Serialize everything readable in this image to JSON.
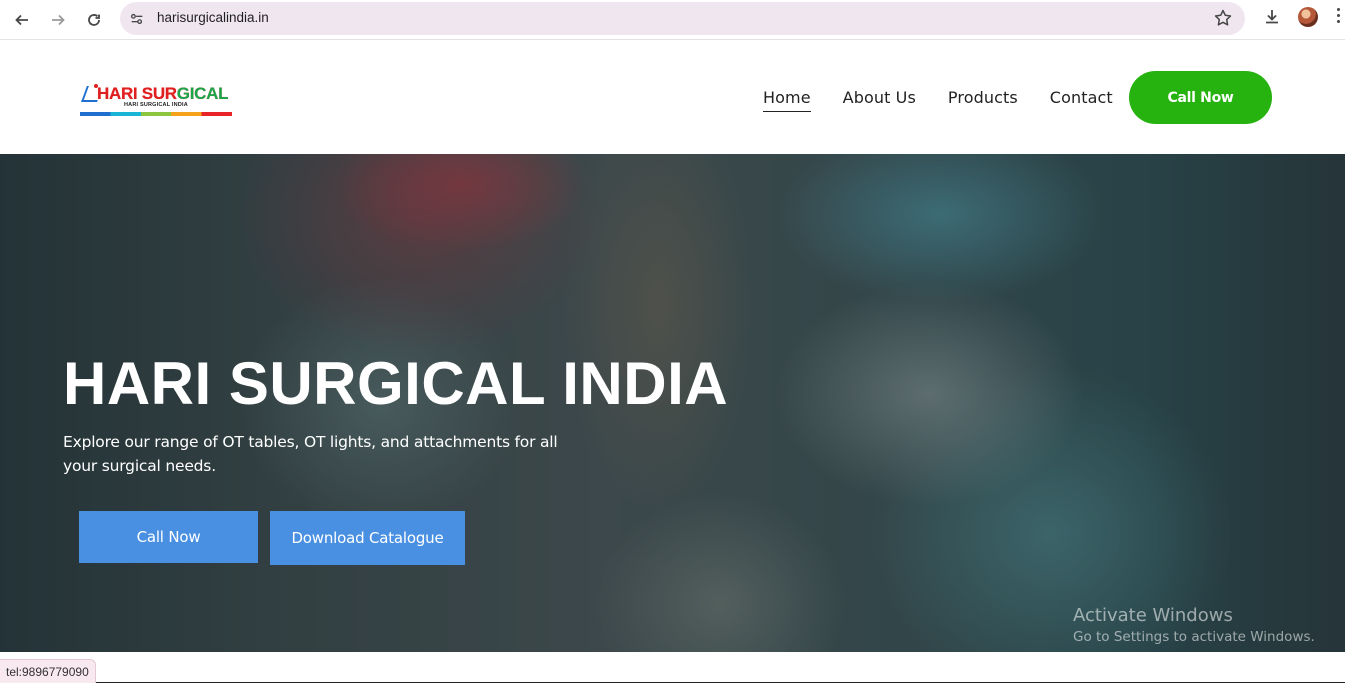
{
  "browser": {
    "url": "harisurgicalindia.in",
    "status_link": "tel:9896779090"
  },
  "header": {
    "logo_text_red": "HARI SUR",
    "logo_text_green": "GICAL",
    "logo_subtext": "HARI SURGICAL INDIA",
    "nav": [
      {
        "label": "Home",
        "active": true
      },
      {
        "label": "About Us"
      },
      {
        "label": "Products"
      },
      {
        "label": "Contact"
      }
    ],
    "call_now_label": "Call Now"
  },
  "hero": {
    "title": "HARI SURGICAL INDIA",
    "description": "Explore our range of OT tables, OT  lights, and attachments for all your surgical needs.",
    "call_button": "Call Now",
    "download_button": "Download Catalogue"
  },
  "watermark": {
    "title": "Activate Windows",
    "subtitle": "Go to Settings to activate Windows."
  },
  "colors": {
    "header_cta": "#26b20f",
    "hero_buttons": "#4a90e2",
    "omnibox": "#f0e6f0"
  }
}
